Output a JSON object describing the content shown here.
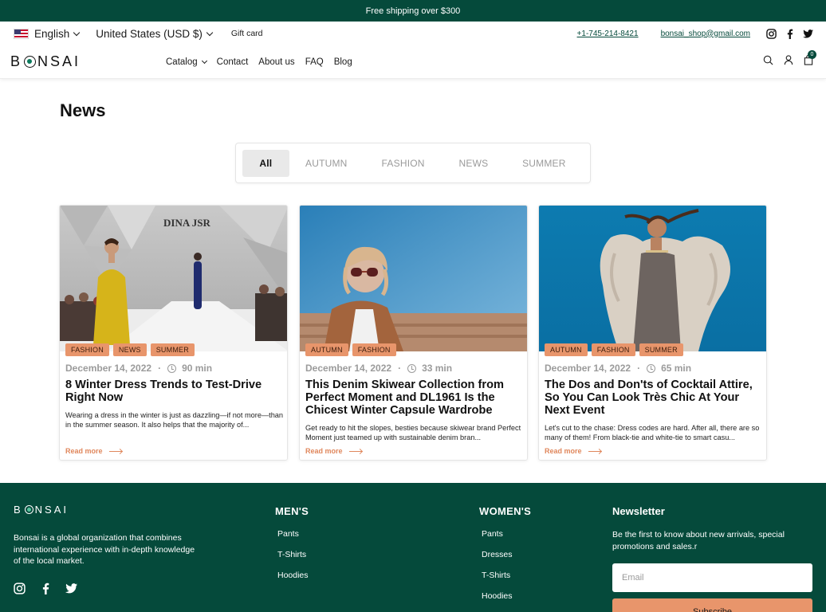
{
  "announcement": "Free shipping over $300",
  "utility": {
    "language": "English",
    "currency": "United States (USD $)",
    "gift_card": "Gift card",
    "phone": "+1-745-214-8421",
    "email": "bonsai_shop@gmail.com",
    "social_icons": [
      "instagram-icon",
      "facebook-icon",
      "twitter-icon"
    ]
  },
  "nav": {
    "logo": "BONSAI",
    "links": [
      "Catalog",
      "Contact",
      "About us",
      "FAQ",
      "Blog"
    ],
    "cart_count": "0"
  },
  "page": {
    "title": "News"
  },
  "filters": {
    "tabs": [
      "All",
      "AUTUMN",
      "FASHION",
      "NEWS",
      "SUMMER"
    ],
    "active": "All"
  },
  "posts": [
    {
      "tags": [
        "FASHION",
        "NEWS",
        "SUMMER"
      ],
      "date": "December 14, 2022",
      "read_time": "90 min",
      "title": "8 Winter Dress Trends to Test-Drive Right Now",
      "excerpt": "Wearing a dress in the winter is just as dazzling—if not more—than in the summer season. It also helps that the majority of...",
      "read_more": "Read more",
      "image_text": "DINA JSR"
    },
    {
      "tags": [
        "AUTUMN",
        "FASHION"
      ],
      "date": "December 14, 2022",
      "read_time": "33 min",
      "title": "This Denim Skiwear Collection from Perfect Moment and DL1961 Is the Chicest Winter Capsule Wardrobe",
      "excerpt": "Get ready to hit the slopes, besties because skiwear brand Perfect Moment just teamed up with sustainable denim bran...",
      "read_more": "Read more"
    },
    {
      "tags": [
        "AUTUMN",
        "FASHION",
        "SUMMER"
      ],
      "date": "December 14, 2022",
      "read_time": "65 min",
      "title": "The Dos and Don'ts of Cocktail Attire, So You Can Look Très Chic At Your Next Event",
      "excerpt": "Let's cut to the chase: Dress codes are hard. After all, there are so many of them! From black-tie and white-tie to smart casu...",
      "read_more": "Read more"
    }
  ],
  "footer": {
    "logo": "BONSAI",
    "about": "Bonsai is a global organization that combines international experience with in-depth knowledge of the local market.",
    "mens_title": "MEN'S",
    "mens_links": [
      "Pants",
      "T-Shirts",
      "Hoodies"
    ],
    "womens_title": "WOMEN'S",
    "womens_links": [
      "Pants",
      "Dresses",
      "T-Shirts",
      "Hoodies"
    ],
    "newsletter_title": "Newsletter",
    "newsletter_desc": "Be the first to know about new arrivals, special promotions and sales.r",
    "email_placeholder": "Email",
    "subscribe_label": "Subscribe"
  },
  "colors": {
    "brand_green": "#054a3b",
    "accent_orange": "#e8956b",
    "link_orange": "#e0875c"
  }
}
